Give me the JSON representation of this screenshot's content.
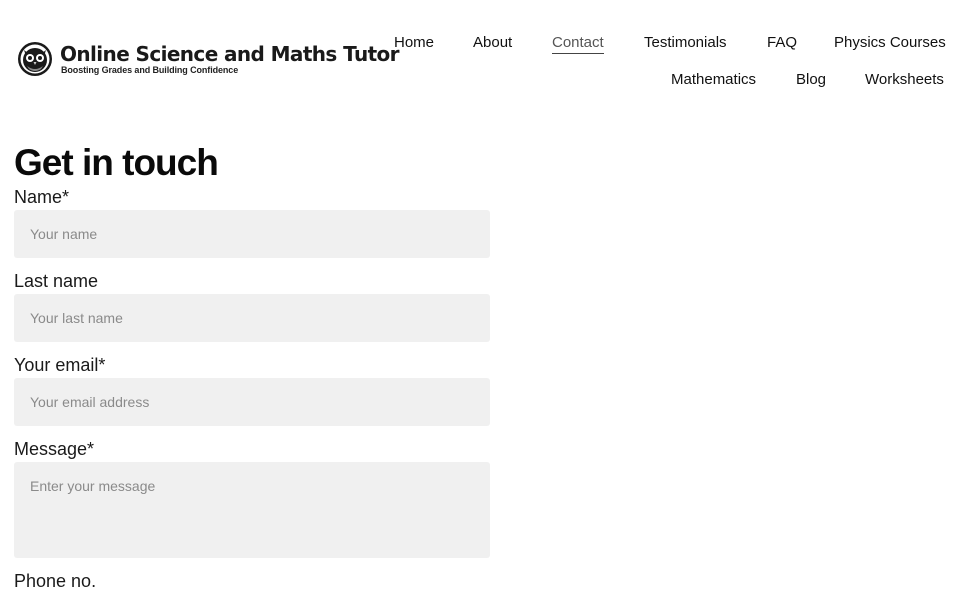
{
  "brand": {
    "title": "Online Science and Maths Tutor",
    "tagline": "Boosting Grades and Building Confidence",
    "logo_icon": "owl-emblem-icon"
  },
  "nav": {
    "home": "Home",
    "about": "About",
    "contact": "Contact",
    "testimonials": "Testimonials",
    "faq": "FAQ",
    "physics": "Physics Courses",
    "mathematics": "Mathematics",
    "blog": "Blog",
    "worksheets": "Worksheets",
    "active": "Contact"
  },
  "form": {
    "heading": "Get in touch",
    "name": {
      "label": "Name*",
      "placeholder": "Your name"
    },
    "last_name": {
      "label": "Last name",
      "placeholder": "Your last name"
    },
    "email": {
      "label": "Your email*",
      "placeholder": "Your email address"
    },
    "message": {
      "label": "Message*",
      "placeholder": "Enter your message"
    },
    "phone": {
      "label": "Phone no."
    }
  },
  "colors": {
    "field_background": "#f0f0f0",
    "text": "#111111",
    "placeholder": "#8a8a8a"
  }
}
